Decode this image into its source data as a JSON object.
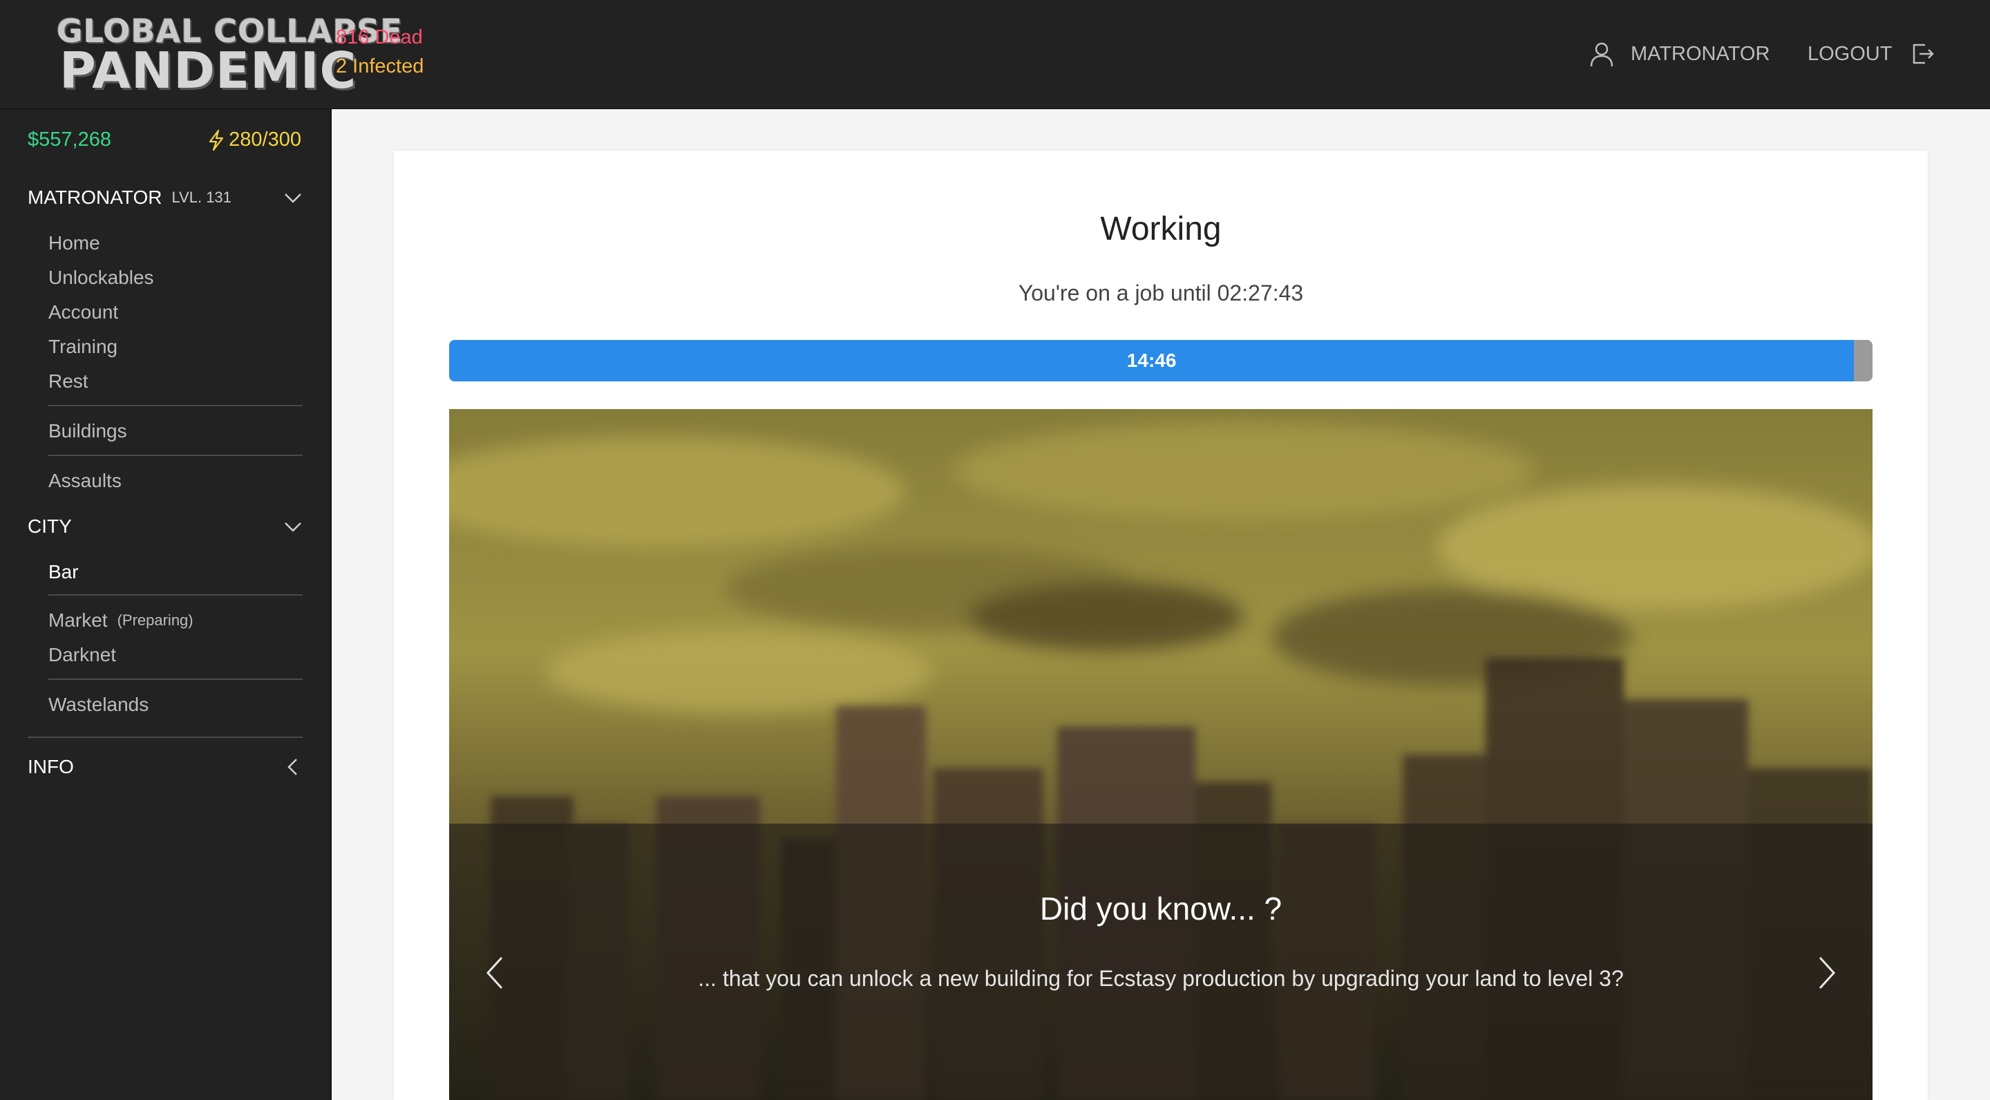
{
  "header": {
    "logo_line1": "GLOBAL COLLAPSE",
    "logo_line2": "PANDEMIC",
    "dead": "816 Dead",
    "infected": "2 Infected",
    "username": "MATRONATOR",
    "logout": "LOGOUT",
    "icons": {
      "user": "user-icon",
      "logout": "logout-icon"
    }
  },
  "sidebar": {
    "money": "$557,268",
    "energy": "280/300",
    "player": {
      "name": "MATRONATOR",
      "level": "LVL. 131"
    },
    "player_items": [
      "Home",
      "Unlockables",
      "Account",
      "Training",
      "Rest"
    ],
    "buildings": "Buildings",
    "assaults": "Assaults",
    "city_label": "CITY",
    "city_items": {
      "bar": "Bar",
      "market": "Market",
      "market_note": "(Preparing)",
      "darknet": "Darknet",
      "wastelands": "Wastelands"
    },
    "info_label": "INFO"
  },
  "main": {
    "title": "Working",
    "subtitle": "You're on a job until 02:27:43",
    "progress": {
      "label": "14:46",
      "percent": 98.7
    },
    "carousel": {
      "title": "Did you know... ?",
      "text": "... that you can unlock a new building for Ecstasy production by upgrading your land to level 3?"
    }
  },
  "colors": {
    "dead": "#ff4d6d",
    "infected": "#f5b942",
    "money": "#3ad68a",
    "energy": "#f5d442",
    "progress": "#2b8be8"
  }
}
